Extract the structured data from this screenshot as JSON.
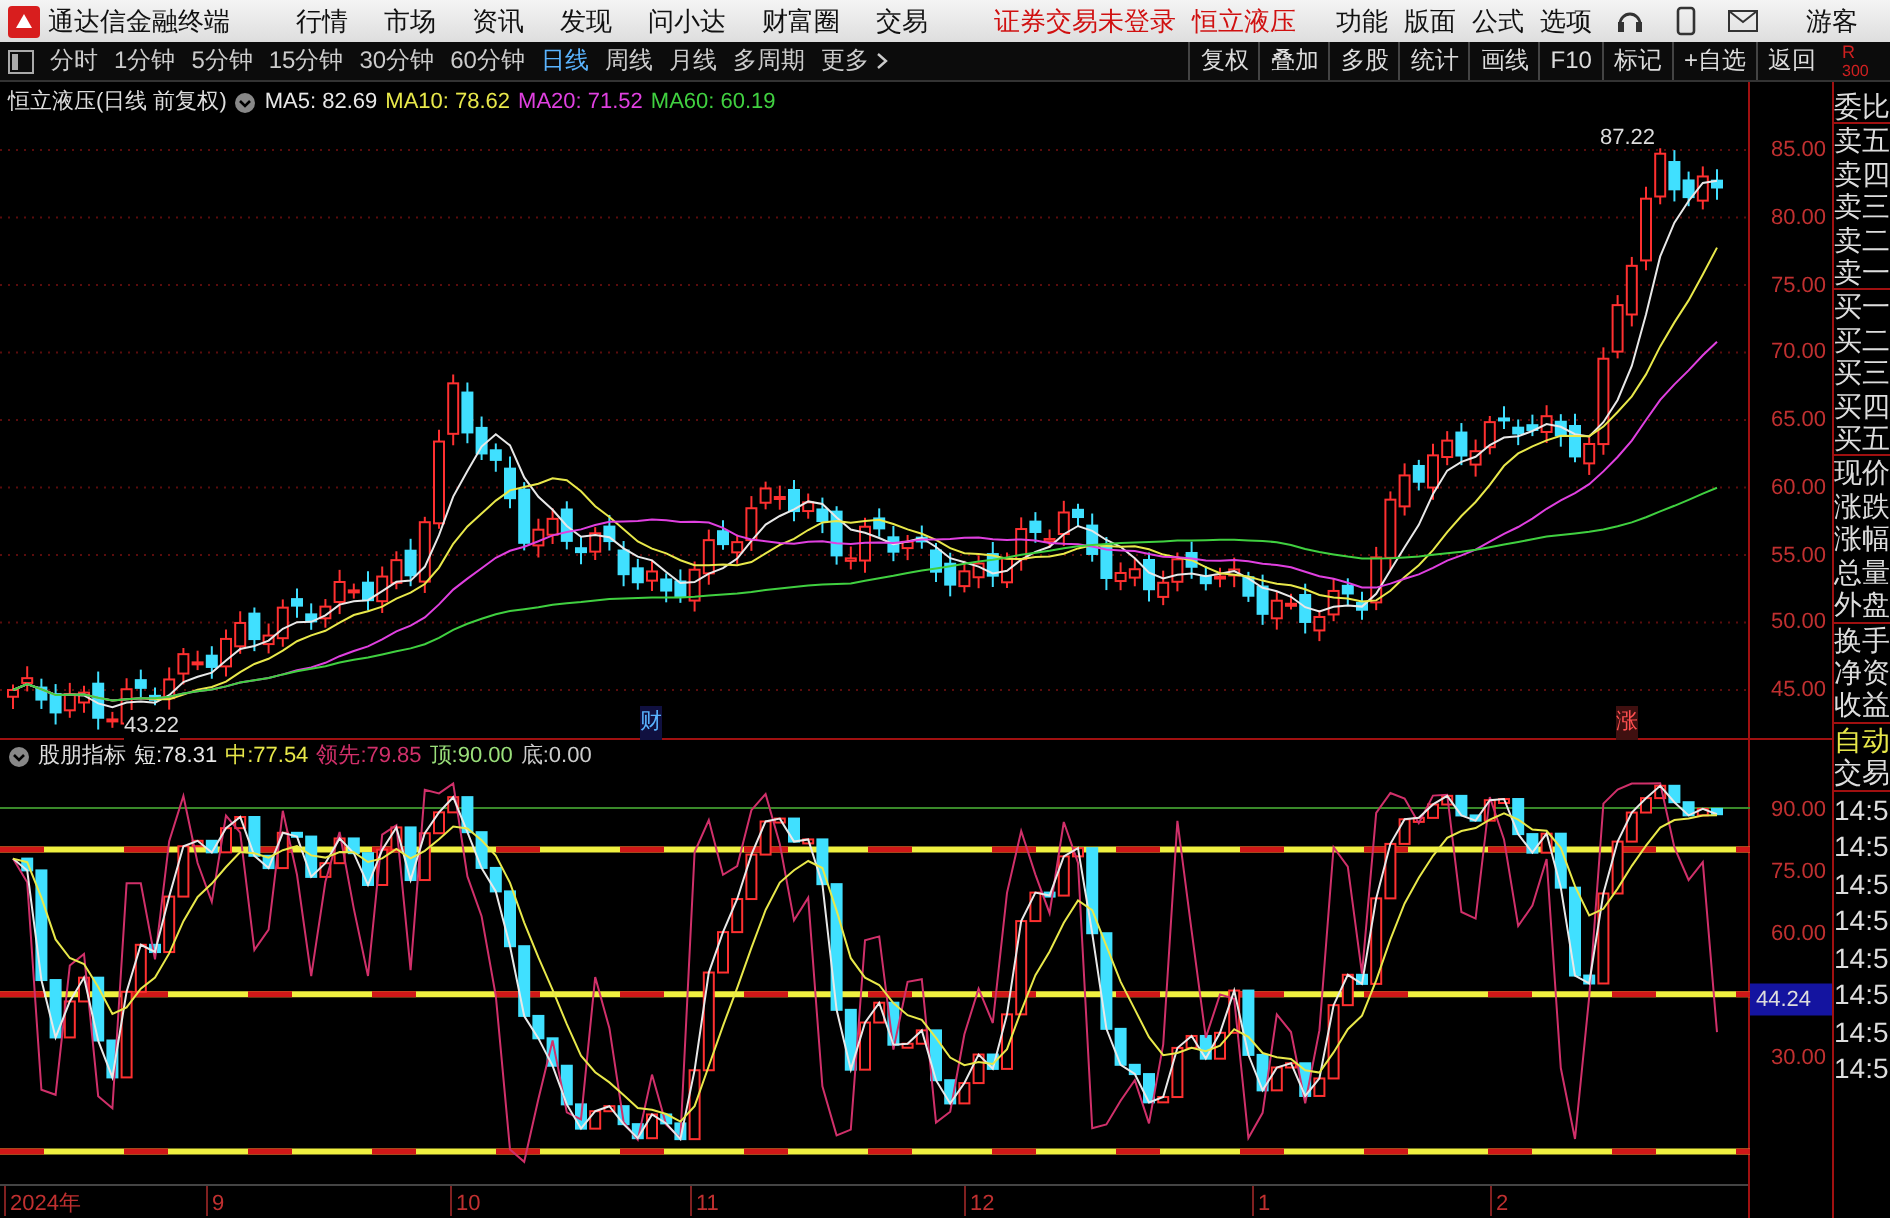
{
  "title_bar": {
    "app_name": "通达信金融终端",
    "menu": [
      "行情",
      "市场",
      "资讯",
      "发现",
      "问小达",
      "财富圈",
      "交易"
    ],
    "login_status": "证券交易未登录",
    "stock_name": "恒立液压",
    "options": [
      "功能",
      "版面",
      "公式",
      "选项"
    ],
    "user": "游客"
  },
  "period_tabs": [
    {
      "label": "分时",
      "selected": false
    },
    {
      "label": "1分钟",
      "selected": false
    },
    {
      "label": "5分钟",
      "selected": false
    },
    {
      "label": "15分钟",
      "selected": false
    },
    {
      "label": "30分钟",
      "selected": false
    },
    {
      "label": "60分钟",
      "selected": false
    },
    {
      "label": "日线",
      "selected": true
    },
    {
      "label": "周线",
      "selected": false
    },
    {
      "label": "月线",
      "selected": false
    },
    {
      "label": "多周期",
      "selected": false
    },
    {
      "label": "更多",
      "selected": false
    }
  ],
  "toolbar_buttons": [
    "复权",
    "叠加",
    "多股",
    "统计",
    "画线",
    "F10",
    "标记",
    "+自选",
    "返回"
  ],
  "main_chart": {
    "title": "恒立液压(日线 前复权)",
    "ma_labels": [
      {
        "label": "MA5: 82.69",
        "color": "#e8e8e8"
      },
      {
        "label": "MA10: 78.62",
        "color": "#e8e84a"
      },
      {
        "label": "MA20: 71.52",
        "color": "#e040e0"
      },
      {
        "label": "MA60: 60.19",
        "color": "#40d040"
      }
    ],
    "price_axis": [
      "85.00",
      "80.00",
      "75.00",
      "70.00",
      "65.00",
      "60.00",
      "55.00",
      "50.00",
      "45.00"
    ],
    "high_label": "87.22",
    "low_label": "43.22",
    "markers": [
      "财",
      "涨"
    ]
  },
  "indicator_chart": {
    "name": "股朋指标",
    "values": [
      {
        "label": "短:78.31",
        "color": "#e8e8e8"
      },
      {
        "label": "中:77.54",
        "color": "#e8e84a"
      },
      {
        "label": "领先:79.85",
        "color": "#d0306a"
      },
      {
        "label": "顶:90.00",
        "color": "#9adf7a"
      },
      {
        "label": "底:0.00",
        "color": "#cccccc"
      }
    ],
    "axis": [
      "90.00",
      "75.00",
      "60.00",
      "30.00"
    ],
    "current_value": "44.24"
  },
  "time_axis": [
    "2024年",
    "9",
    "10",
    "11",
    "12",
    "1",
    "2"
  ],
  "side_panel": {
    "corner": "R",
    "corner_sub": "300",
    "quote_groups": [
      [
        "委比"
      ],
      [
        "卖五",
        "卖四",
        "卖三",
        "卖二",
        "卖一"
      ],
      [
        "买一",
        "买二",
        "买三",
        "买四",
        "买五"
      ],
      [
        "现价",
        "涨跌",
        "涨幅",
        "总量",
        "外盘"
      ],
      [
        "换手",
        "净资",
        "收益"
      ],
      [
        "自动",
        "交易"
      ]
    ],
    "times": [
      "14:5",
      "14:5",
      "14:5",
      "14:5",
      "14:5",
      "14:5",
      "14:5",
      "14:5"
    ]
  }
}
